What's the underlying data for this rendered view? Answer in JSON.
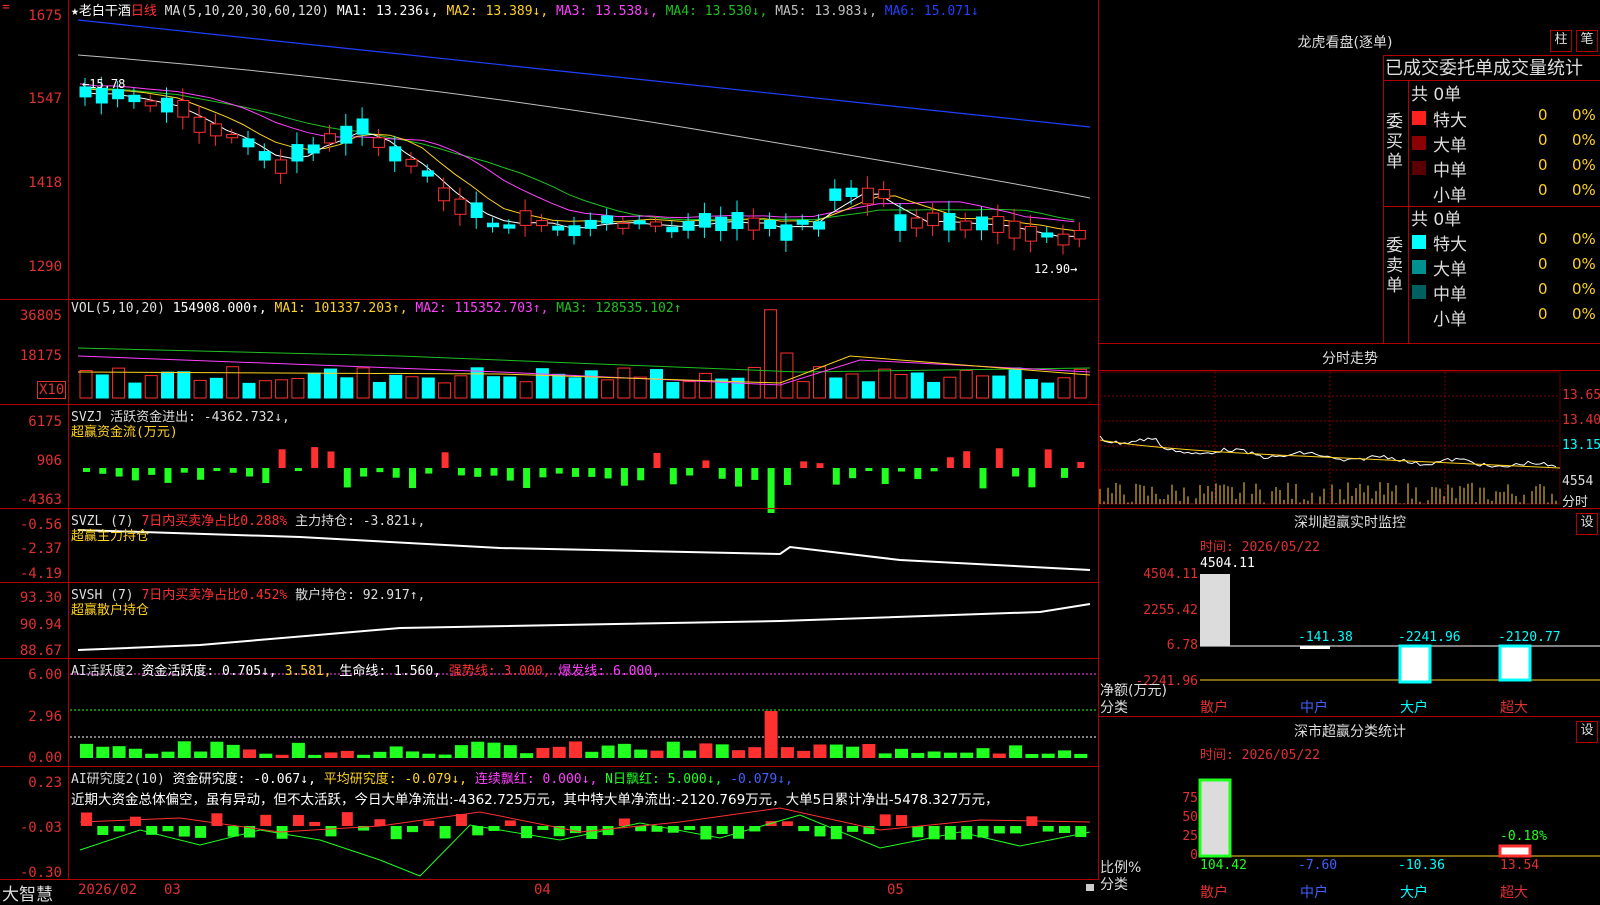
{
  "top_marker": "=",
  "main_chart": {
    "stock_name": "★老白干酒",
    "period": "日线",
    "ma_label": "MA(5,10,20,30,60,120)",
    "ma1": "MA1: 13.236↓,",
    "ma2": "MA2: 13.389↓,",
    "ma3": "MA3: 13.538↓,",
    "ma4": "MA4: 13.530↓,",
    "ma5": "MA5: 13.983↓,",
    "ma6": "MA6: 15.071↓",
    "y_ticks": [
      "1675",
      "1547",
      "1418",
      "1290"
    ],
    "high_label": "15.78",
    "low_label": "12.90"
  },
  "vol_panel": {
    "title": "VOL(5,10,20)",
    "value": "154908.000↑,",
    "ma1": "MA1: 101337.203↑,",
    "ma2": "MA2: 115352.703↑,",
    "ma3": "MA3: 128535.102↑",
    "y_ticks": [
      "36805",
      "18175"
    ],
    "unit": "X10"
  },
  "svzj_panel": {
    "title": "SVZJ  活跃资金进出: -4362.732↓,",
    "subtitle": "超赢资金流(万元)",
    "y_ticks": [
      "6175",
      "906",
      "-4363"
    ]
  },
  "svzl_panel": {
    "title_a": "SVZL (7)",
    "title_b": "7日内买卖净占比0.288%",
    "title_c": "主力持仓: -3.821↓,",
    "subtitle": "超赢主力持仓",
    "y_ticks": [
      "-0.56",
      "-2.37",
      "-4.19"
    ]
  },
  "svsh_panel": {
    "title_a": "SVSH (7)",
    "title_b": "7日内买卖净占比0.452%",
    "title_c": "散户持仓: 92.917↑,",
    "subtitle": "超赢散户持仓",
    "y_ticks": [
      "93.30",
      "90.94",
      "88.67"
    ]
  },
  "ai_active_panel": {
    "title_a": "AI活跃度2",
    "title_b": "资金活跃度: 0.705↓,",
    "title_c": "3.581,",
    "title_d": "生命线: 1.560,",
    "title_e": "强势线: 3.000,",
    "title_f": "爆发线: 6.000,",
    "y_ticks": [
      "6.00",
      "2.96",
      "0.00"
    ]
  },
  "ai_research_panel": {
    "title_a": "AI研究度2(10)",
    "title_b": "资金研究度: -0.067↓,",
    "title_c": "平均研究度: -0.079↓,",
    "title_d": "连续飘红: 0.000↓,",
    "title_e": "N日飘红: 5.000↓,",
    "title_f": "-0.079↓,",
    "comment": "近期大资金总体偏空，虽有异动，但不太活跃，今日大单净流出:-4362.725万元，其中特大单净流出:-2120.769万元，大单5日累计净出-5478.327万元，",
    "y_ticks": [
      "0.23",
      "-0.03",
      "-0.30"
    ]
  },
  "bottom_bar": {
    "brand": "大智慧",
    "date_start": "2026/02",
    "month_03": "03",
    "month_04": "04",
    "month_05": "05"
  },
  "right_panel": {
    "dragon_title": "龙虎看盘(逐单)",
    "btn_bar": "柱",
    "btn_pen": "笔",
    "stats_title": "已成交委托单成交量统计",
    "buy_label": "委买单",
    "sell_label": "委卖单",
    "buy_total": "共 0单",
    "sell_total": "共 0单",
    "buy_rows": [
      {
        "label": "特大",
        "count": "0",
        "pct": "0%",
        "color": "#ff2020"
      },
      {
        "label": "大单",
        "count": "0",
        "pct": "0%",
        "color": "#8b0000"
      },
      {
        "label": "中单",
        "count": "0",
        "pct": "0%",
        "color": "#5a0000"
      },
      {
        "label": "小单",
        "count": "0",
        "pct": "0%",
        "color": "#000000"
      }
    ],
    "sell_rows": [
      {
        "label": "特大",
        "count": "0",
        "pct": "0%",
        "color": "#00ffff"
      },
      {
        "label": "大单",
        "count": "0",
        "pct": "0%",
        "color": "#009090"
      },
      {
        "label": "中单",
        "count": "0",
        "pct": "0%",
        "color": "#006060"
      },
      {
        "label": "小单",
        "count": "0",
        "pct": "0%",
        "color": "#000000"
      }
    ],
    "intraday_title": "分时走势",
    "intraday_prices": [
      "13.65",
      "13.40",
      "13.15"
    ],
    "intraday_vol": "4554",
    "intraday_unit": "分时",
    "sz_monitor_title": "深圳超赢实时监控",
    "sz_monitor_btn": "设",
    "sz_monitor_time": "时间: 2026/05/22",
    "sz_monitor_y": [
      "4504.11",
      "2255.42",
      "6.78",
      "-2241.96"
    ],
    "sz_monitor_values": [
      "4504.11",
      "-141.38",
      "-2241.96",
      "-2120.77"
    ],
    "sz_monitor_ylabel": "净额(万元)",
    "sz_monitor_xlabel": "分类",
    "categories": [
      "散户",
      "中户",
      "大户",
      "超大"
    ],
    "sz_class_title": "深市超赢分类统计",
    "sz_class_btn": "设",
    "sz_class_time": "时间: 2026/05/22",
    "sz_class_y": [
      "75",
      "50",
      "25",
      "0"
    ],
    "sz_class_values": [
      "104.42",
      "-7.60",
      "-10.36",
      "13.54"
    ],
    "sz_class_extra": "-0.18%",
    "sz_class_ylabel": "比例%",
    "sz_class_xlabel": "分类"
  },
  "colors": {
    "up": "#ff3030",
    "down": "#00ffff",
    "grid": "#b00000",
    "ma1": "#ffffff",
    "ma2": "#ffd21f",
    "ma3": "#ff40ff",
    "ma4": "#20c020",
    "ma5": "#c0c0c0",
    "ma6": "#2040ff"
  }
}
